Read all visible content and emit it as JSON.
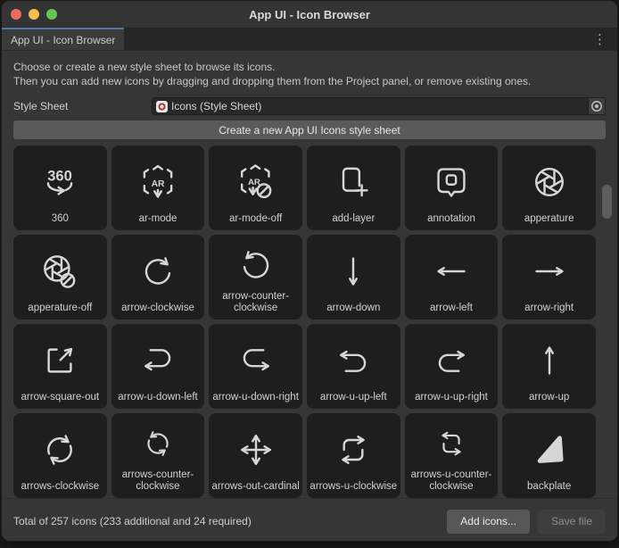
{
  "window": {
    "title": "App UI - Icon Browser"
  },
  "tab": {
    "label": "App UI - Icon Browser"
  },
  "description": {
    "line1": "Choose or create a new style sheet to browse its icons.",
    "line2": "Then you can add new icons by dragging and dropping them from the Project panel, or remove existing ones."
  },
  "style_sheet": {
    "label": "Style Sheet",
    "value": "Icons (Style Sheet)"
  },
  "create_button": {
    "label": "Create a new App UI Icons style sheet"
  },
  "icons": [
    "360",
    "ar-mode",
    "ar-mode-off",
    "add-layer",
    "annotation",
    "apperature",
    "apperature-off",
    "arrow-clockwise",
    "arrow-counter-clockwise",
    "arrow-down",
    "arrow-left",
    "arrow-right",
    "arrow-square-out",
    "arrow-u-down-left",
    "arrow-u-down-right",
    "arrow-u-up-left",
    "arrow-u-up-right",
    "arrow-up",
    "arrows-clockwise",
    "arrows-counter-clockwise",
    "arrows-out-cardinal",
    "arrows-u-clockwise",
    "arrows-u-counter-clockwise",
    "backplate"
  ],
  "footer": {
    "status": "Total of 257 icons (233 additional and 24 required)",
    "add_button_label": "Add icons...",
    "save_button_label": "Save file"
  },
  "colors": {
    "tab_accent": "#4a7aab",
    "traffic_red": "#ee6a5f",
    "traffic_yellow": "#f5bf4f",
    "traffic_green": "#62c554",
    "icon_stroke": "#d6d6d6"
  }
}
